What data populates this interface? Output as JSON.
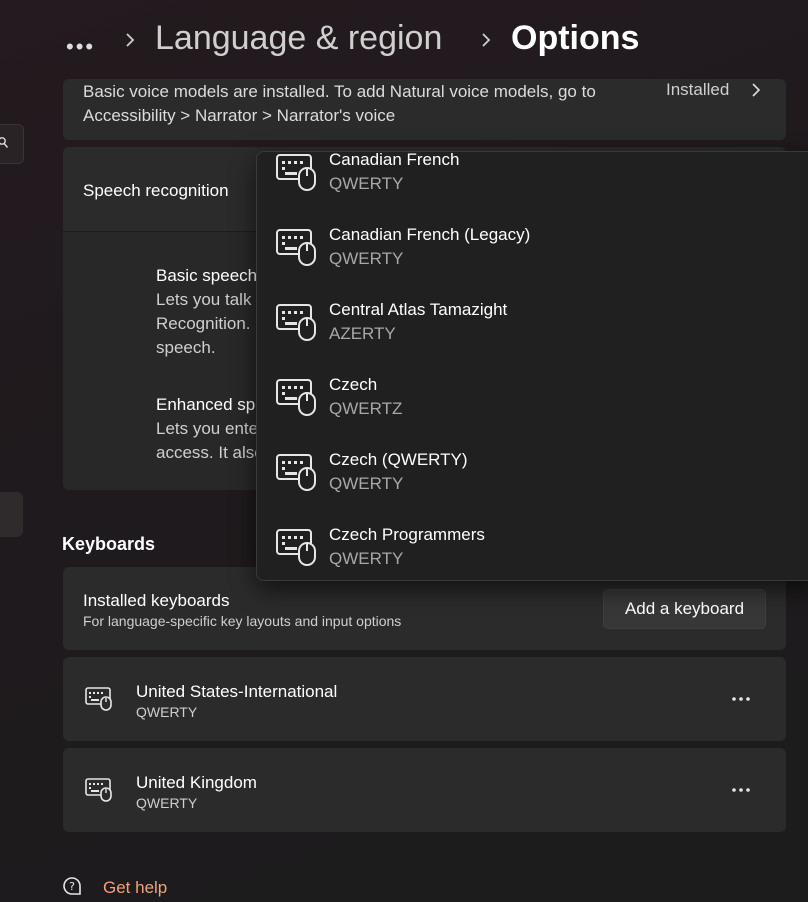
{
  "breadcrumb": {
    "more": "•••",
    "parent": "Language & region",
    "current": "Options"
  },
  "voice": {
    "description": "Basic voice models are installed. To add Natural voice models, go to Accessibility > Narrator > Narrator's voice",
    "status": "Installed"
  },
  "speech": {
    "label": "Speech recognition",
    "options": [
      {
        "title": "Basic speech",
        "description": "Lets you talk Recognition. speech."
      },
      {
        "title": "Enhanced sp",
        "description": "Lets you ente access. It also"
      }
    ]
  },
  "keyboards": {
    "section_title": "Keyboards",
    "installed_title": "Installed keyboards",
    "installed_subtitle": "For language-specific key layouts and input options",
    "add_button": "Add a keyboard",
    "items": [
      {
        "name": "United States-International",
        "layout": "QWERTY",
        "more": "more-options-icon"
      },
      {
        "name": "United Kingdom",
        "layout": "QWERTY",
        "more": "more-options-icon"
      }
    ]
  },
  "dropdown": {
    "items": [
      {
        "name": "Canadian French",
        "layout": "QWERTY"
      },
      {
        "name": "Canadian French (Legacy)",
        "layout": "QWERTY"
      },
      {
        "name": "Central Atlas Tamazight",
        "layout": "AZERTY"
      },
      {
        "name": "Czech",
        "layout": "QWERTZ"
      },
      {
        "name": "Czech (QWERTY)",
        "layout": "QWERTY"
      },
      {
        "name": "Czech Programmers",
        "layout": "QWERTY"
      }
    ]
  },
  "help": {
    "label": "Get help"
  },
  "colors": {
    "accent_link": "#f0a37c",
    "card": "#2b2b2b",
    "flyout": "#202020"
  }
}
